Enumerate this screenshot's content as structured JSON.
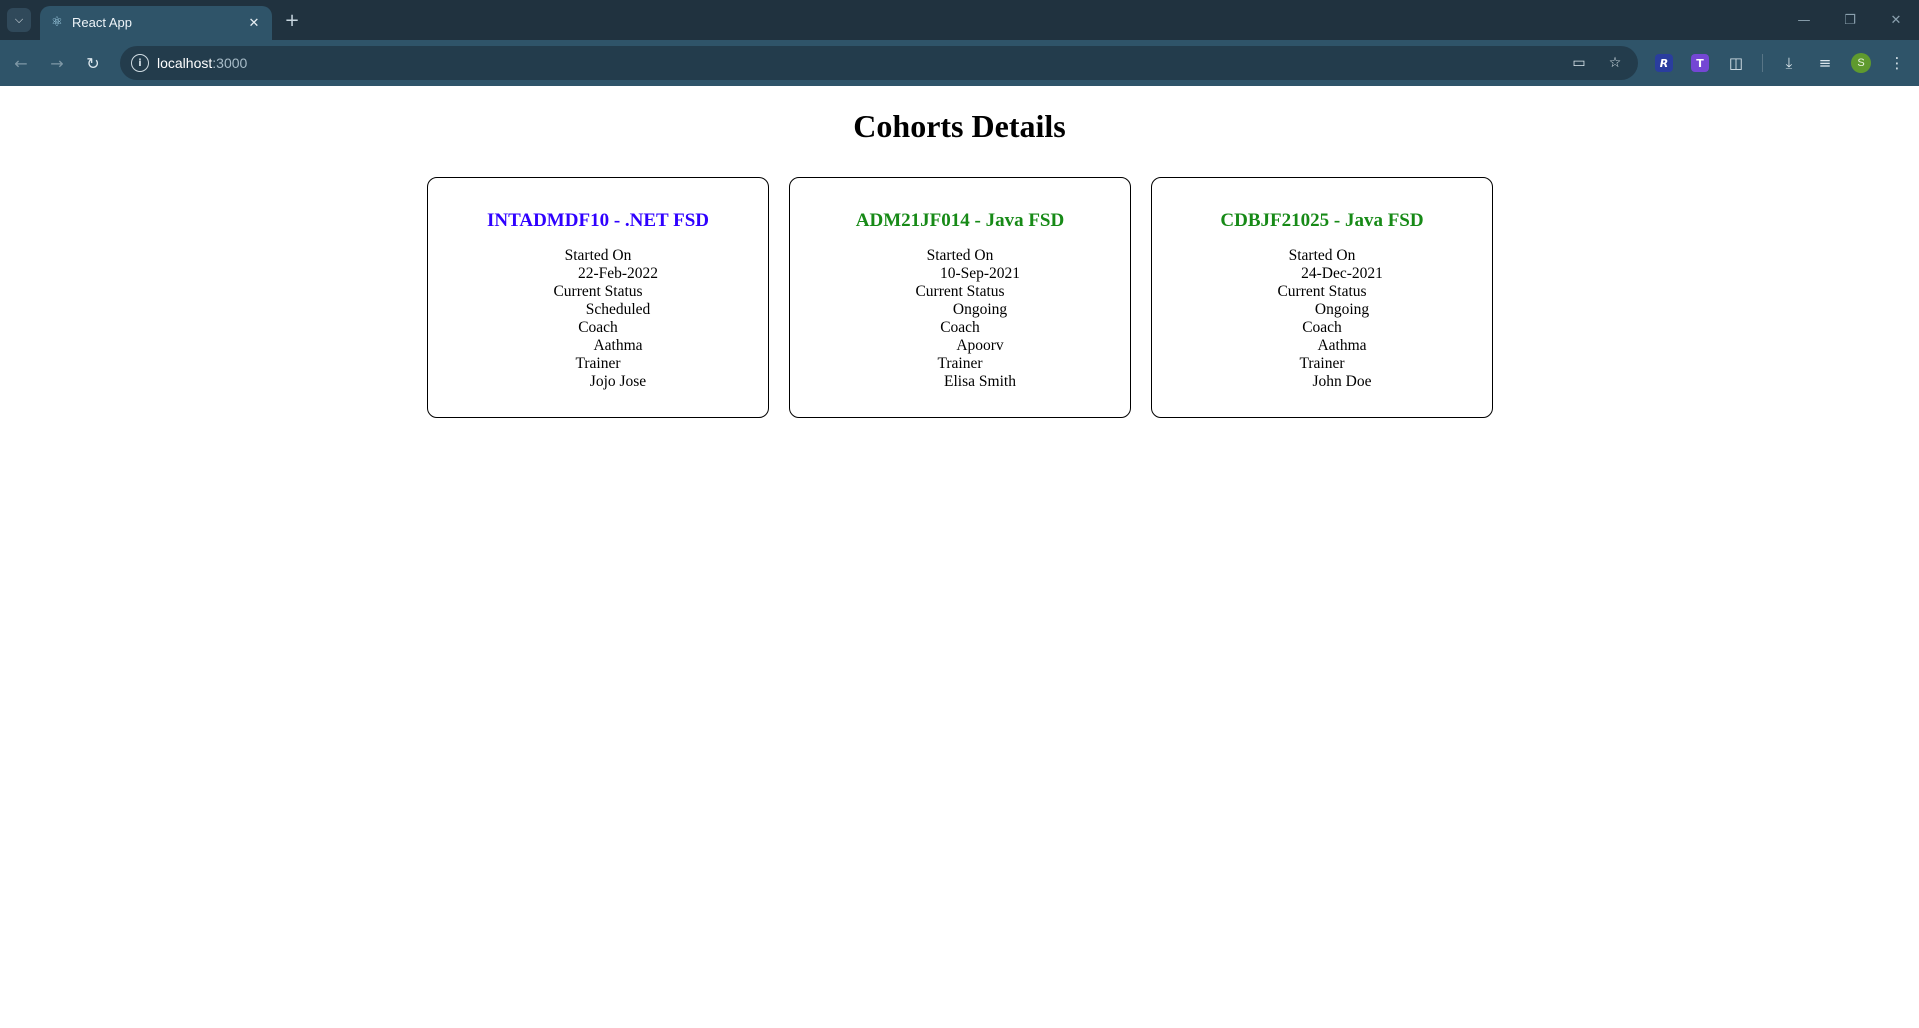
{
  "browser": {
    "tab_title": "React App",
    "url_host": "localhost",
    "url_port": ":3000",
    "profile_initial": "S"
  },
  "page": {
    "title": "Cohorts Details"
  },
  "labels": {
    "started_on": "Started On",
    "current_status": "Current Status",
    "coach": "Coach",
    "trainer": "Trainer"
  },
  "cohorts": [
    {
      "title": "INTADMDF10 - .NET FSD",
      "title_color": "#2f00ff",
      "started_on": "22-Feb-2022",
      "status": "Scheduled",
      "coach": "Aathma",
      "trainer": "Jojo Jose"
    },
    {
      "title": "ADM21JF014 - Java FSD",
      "title_color": "#178a17",
      "started_on": "10-Sep-2021",
      "status": "Ongoing",
      "coach": "Apoorv",
      "trainer": "Elisa Smith"
    },
    {
      "title": "CDBJF21025 - Java FSD",
      "title_color": "#178a17",
      "started_on": "24-Dec-2021",
      "status": "Ongoing",
      "coach": "Aathma",
      "trainer": "John Doe"
    }
  ],
  "icons": {
    "tab_search": "chevron-down-icon",
    "favicon": "react-icon",
    "close": "close-icon",
    "new_tab": "plus-icon",
    "back": "arrow-left-icon",
    "forward": "arrow-right-icon",
    "reload": "reload-icon",
    "site_info": "info-icon",
    "install": "install-app-icon",
    "bookmark": "star-icon",
    "extensions": "puzzle-icon",
    "downloads": "download-icon",
    "reading_list": "reading-list-icon",
    "menu": "kebab-menu-icon"
  }
}
